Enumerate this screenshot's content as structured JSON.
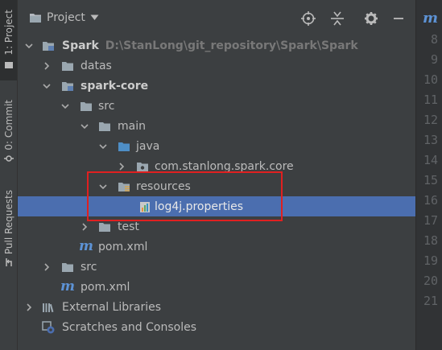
{
  "side_tabs": {
    "project": "1: Project",
    "commit": "0: Commit",
    "pull_requests": "Pull Requests"
  },
  "header": {
    "title": "Project"
  },
  "tree": {
    "root_name": "Spark",
    "root_path": "D:\\StanLong\\git_repository\\Spark\\Spark",
    "datas": "datas",
    "spark_core": "spark-core",
    "src": "src",
    "main": "main",
    "java": "java",
    "package": "com.stanlong.spark.core",
    "resources": "resources",
    "log4j": "log4j.properties",
    "test": "test",
    "core_pom": "pom.xml",
    "root_src": "src",
    "root_pom": "pom.xml",
    "external_libraries": "External Libraries",
    "scratches": "Scratches and Consoles"
  },
  "editor_gutter": {
    "line_numbers": [
      "8",
      "9",
      "10",
      "11",
      "12",
      "13",
      "14",
      "15",
      "16",
      "17",
      "18",
      "19",
      "20",
      "21"
    ]
  },
  "colors": {
    "selection": "#4b6eaf",
    "highlight_box": "#e02020",
    "maven_blue": "#5d93d6"
  }
}
